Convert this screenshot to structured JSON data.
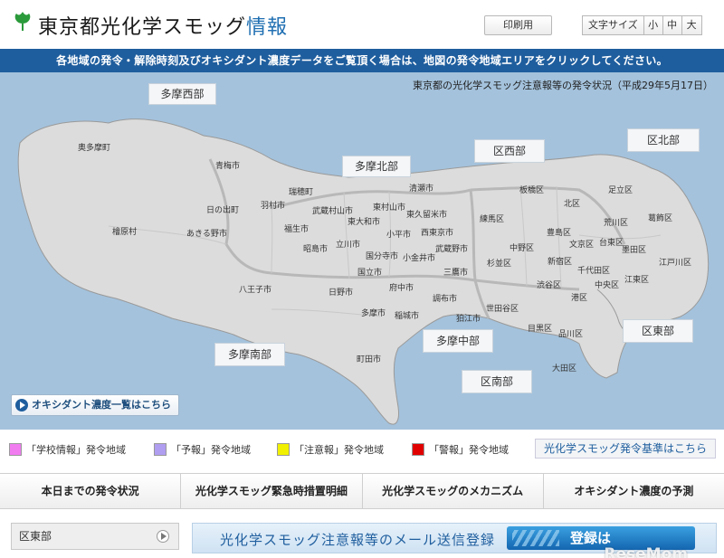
{
  "header": {
    "title_main": "東京都光化学スモッグ",
    "title_accent": "情報",
    "print_label": "印刷用",
    "font_size_label": "文字サイズ",
    "font_sizes": [
      "小",
      "中",
      "大"
    ]
  },
  "banner": {
    "text": "各地域の発令・解除時刻及びオキシダント濃度データをご覧頂く場合は、地図の発令地域エリアをクリックしてください。"
  },
  "map": {
    "status": "東京都の光化学スモッグ注意報等の発令状況（平成29年5月17日）",
    "regions": [
      "多摩西部",
      "多摩北部",
      "区西部",
      "区北部",
      "多摩中部",
      "多摩南部",
      "区南部",
      "区東部"
    ],
    "municipalities": {
      "okutama": "奥多摩町",
      "ome": "青梅市",
      "hinode": "日の出町",
      "akiruno": "あきる野市",
      "hinohara": "檜原村",
      "hamura": "羽村市",
      "mizuho": "瑞穂町",
      "musashimurayama": "武蔵村山市",
      "higashiyamato": "東大和市",
      "higashimurayama": "東村山市",
      "kiyose": "清瀬市",
      "higashikurume": "東久留米市",
      "nishitokyo": "西東京市",
      "kodaira": "小平市",
      "fussa": "福生市",
      "akishima": "昭島市",
      "tachikawa": "立川市",
      "kokubunji": "国分寺市",
      "koganei": "小金井市",
      "musashino": "武蔵野市",
      "mitaka": "三鷹市",
      "kunitachi": "国立市",
      "fuchu": "府中市",
      "chofu": "調布市",
      "komae": "狛江市",
      "hino": "日野市",
      "hachioji": "八王子市",
      "tama": "多摩市",
      "inagi": "稲城市",
      "machida": "町田市",
      "itabashi": "板橋区",
      "kita": "北区",
      "adachi": "足立区",
      "nerima": "練馬区",
      "arakawa": "荒川区",
      "katsushika": "葛飾区",
      "toshima": "豊島区",
      "bunkyo": "文京区",
      "taito": "台東区",
      "sumida": "墨田区",
      "nakano": "中野区",
      "suginami": "杉並区",
      "shinjuku": "新宿区",
      "chiyoda": "千代田区",
      "edogawa": "江戸川区",
      "koto": "江東区",
      "shibuya": "渋谷区",
      "minato": "港区",
      "chuo": "中央区",
      "setagaya": "世田谷区",
      "meguro": "目黒区",
      "shinagawa": "品川区",
      "ota": "大田区"
    },
    "oxidant_link": "オキシダント濃度一覧はこちら"
  },
  "legend": {
    "items": [
      {
        "label": "「学校情報」発令地域",
        "color": "#f07cf0"
      },
      {
        "label": "「予報」発令地域",
        "color": "#b09ef0"
      },
      {
        "label": "「注意報」発令地域",
        "color": "#f0f000"
      },
      {
        "label": "「警報」発令地域",
        "color": "#e00000"
      }
    ],
    "criteria_link": "光化学スモッグ発令基準はこちら"
  },
  "nav": {
    "tabs": [
      "本日までの発令状況",
      "光化学スモッグ緊急時措置明細",
      "光化学スモッグのメカニズム",
      "オキシダント濃度の予測"
    ]
  },
  "bottom": {
    "region_select": "区東部",
    "mail_text": "光化学スモッグ注意報等のメール送信登録",
    "register_label": "登録は",
    "watermark": "ReseMom"
  },
  "colors": {
    "brand_blue": "#1f5e9e",
    "map_sea": "#a4c2dc",
    "land": "#dcdcdc"
  }
}
